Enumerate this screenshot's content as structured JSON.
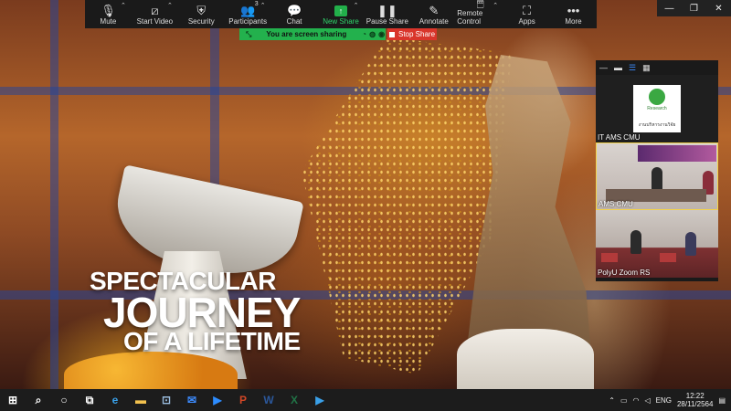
{
  "toolbar": {
    "items": [
      {
        "label": "Mute",
        "icon": "microphone-icon",
        "caret": true
      },
      {
        "label": "Start Video",
        "icon": "video-off-icon",
        "caret": true
      },
      {
        "label": "Security",
        "icon": "shield-icon",
        "caret": false
      },
      {
        "label": "Participants",
        "icon": "participants-icon",
        "badge": "3",
        "caret": true
      },
      {
        "label": "Chat",
        "icon": "chat-icon",
        "caret": false
      },
      {
        "label": "New Share",
        "icon": "share-arrow-icon",
        "caret": true
      },
      {
        "label": "Pause Share",
        "icon": "pause-icon",
        "caret": false
      },
      {
        "label": "Annotate",
        "icon": "pencil-icon",
        "caret": false
      },
      {
        "label": "Remote Control",
        "icon": "mouse-icon",
        "caret": true
      },
      {
        "label": "Apps",
        "icon": "apps-icon",
        "caret": false
      },
      {
        "label": "More",
        "icon": "more-dots-icon",
        "caret": false
      }
    ]
  },
  "share_banner": {
    "status": "You are screen sharing",
    "stop_label": "Stop Share",
    "status_color": "#23b14d",
    "stop_color": "#d9352b"
  },
  "slide": {
    "line1": "SPECTACULAR",
    "line2": "JOURNEY",
    "line3": "OF A LIFETIME"
  },
  "gallery": {
    "tiles": [
      {
        "name": "IT AMS CMU",
        "logo_word": "Research",
        "logo_thai": "งานบริหารงานวิจัย"
      },
      {
        "name": "AMS CMU"
      },
      {
        "name": "PolyU Zoom RS"
      }
    ]
  },
  "taskbar": {
    "language": "ENG",
    "time": "12:22",
    "date": "28/11/2564",
    "apps": [
      "windows-start-icon",
      "search-icon",
      "cortana-icon",
      "task-view-icon",
      "edge-icon",
      "file-explorer-icon",
      "store-icon",
      "mail-icon",
      "zoom-icon",
      "powerpoint-icon",
      "word-icon",
      "excel-icon",
      "media-icon"
    ]
  }
}
